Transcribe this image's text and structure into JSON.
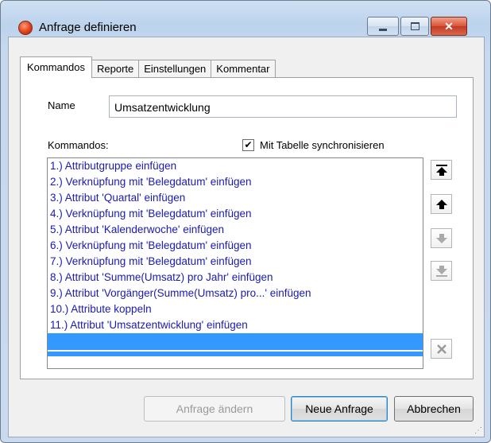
{
  "window": {
    "title": "Anfrage definieren",
    "buttons": {
      "minimize": "minimize",
      "maximize": "maximize",
      "close": "✕"
    }
  },
  "tabs": [
    {
      "label": "Kommandos",
      "active": true
    },
    {
      "label": "Reporte",
      "active": false
    },
    {
      "label": "Einstellungen",
      "active": false
    },
    {
      "label": "Kommentar",
      "active": false
    }
  ],
  "form": {
    "name_label": "Name",
    "name_value": "Umsatzentwicklung",
    "commands_label": "Kommandos:",
    "sync_checkbox_label": "Mit Tabelle synchronisieren",
    "sync_checked": true
  },
  "commands": [
    "1.) Attributgruppe einfügen",
    "2.) Verknüpfung mit 'Belegdatum' einfügen",
    "3.) Attribut 'Quartal' einfügen",
    "4.) Verknüpfung mit 'Belegdatum' einfügen",
    "5.) Attribut 'Kalenderwoche' einfügen",
    "6.) Verknüpfung mit 'Belegdatum' einfügen",
    "7.) Verknüpfung mit 'Belegdatum' einfügen",
    "8.) Attribut 'Summe(Umsatz) pro Jahr' einfügen",
    "9.) Attribut 'Vorgänger(Summe(Umsatz) pro...' einfügen",
    "10.) Attribute koppeln",
    "11.) Attribut 'Umsatzentwicklung' einfügen"
  ],
  "side_buttons": {
    "to_top": "move-to-top-icon",
    "up": "move-up-icon",
    "down": "move-down-icon",
    "to_bottom": "move-to-bottom-icon",
    "delete": "delete-icon"
  },
  "buttons": {
    "change": "Anfrage ändern",
    "new": "Neue Anfrage",
    "cancel": "Abbrechen"
  },
  "colors": {
    "list_text": "#1a1ab2",
    "selection": "#3399ff"
  }
}
